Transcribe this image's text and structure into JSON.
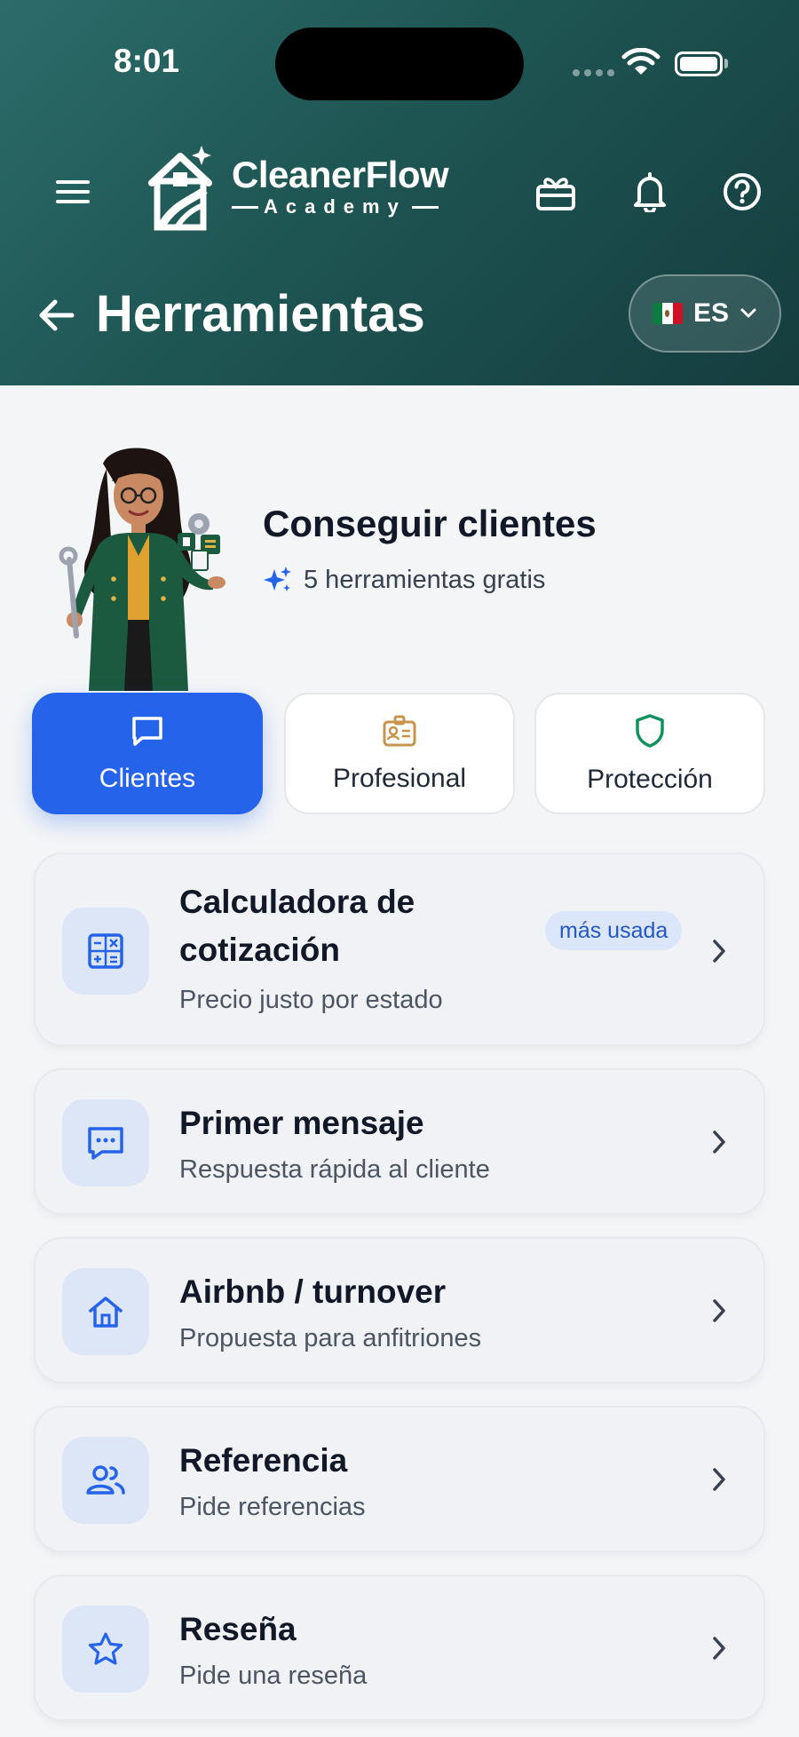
{
  "status_bar": {
    "time": "8:01"
  },
  "header": {
    "logo": {
      "name": "CleanerFlow",
      "subtitle": "Academy"
    },
    "title": "Herramientas",
    "language": {
      "code": "ES"
    }
  },
  "hero": {
    "title": "Conseguir clientes",
    "subtitle": "5 herramientas gratis"
  },
  "tabs": [
    {
      "label": "Clientes",
      "icon": "chat-icon",
      "active": true
    },
    {
      "label": "Profesional",
      "icon": "id-badge-icon",
      "active": false
    },
    {
      "label": "Protección",
      "icon": "shield-icon",
      "active": false
    }
  ],
  "tools": [
    {
      "title": "Calculadora de cotización",
      "title_line1": "Calculadora de",
      "title_line2": "cotización",
      "description": "Precio justo por estado",
      "badge": "más usada",
      "icon": "calculator-icon"
    },
    {
      "title": "Primer mensaje",
      "description": "Respuesta rápida al cliente",
      "icon": "message-icon"
    },
    {
      "title": "Airbnb / turnover",
      "description": "Propuesta para anfitriones",
      "icon": "home-icon"
    },
    {
      "title": "Referencia",
      "description": "Pide referencias",
      "icon": "users-icon"
    },
    {
      "title": "Reseña",
      "description": "Pide una reseña",
      "icon": "star-icon"
    }
  ],
  "colors": {
    "header_start": "#2b6c6a",
    "header_end": "#153d3e",
    "accent": "#2563eb",
    "background": "#f3f5f7"
  }
}
